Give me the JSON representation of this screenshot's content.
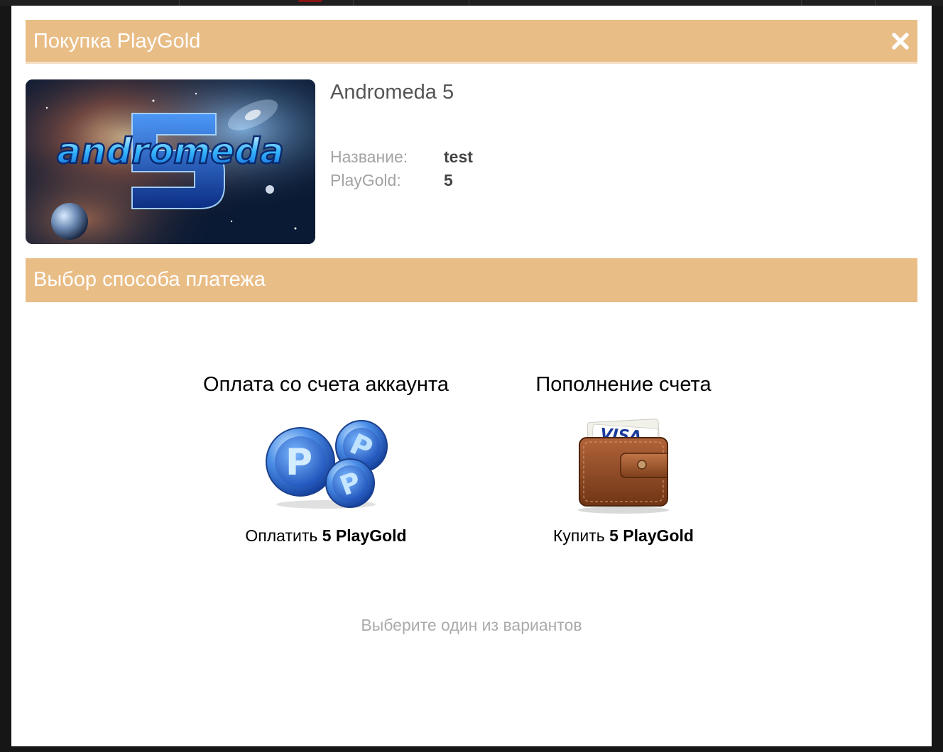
{
  "dialog": {
    "title": "Покупка PlayGold",
    "close_icon": "close-icon"
  },
  "product": {
    "image_alt": "andromeda",
    "image_number": "5",
    "name": "Andromeda 5",
    "fields": [
      {
        "label": "Название:",
        "value": "test"
      },
      {
        "label": "PlayGold:",
        "value": "5"
      }
    ]
  },
  "payment": {
    "section_title": "Выбор способа платежа",
    "options": [
      {
        "title": "Оплата со счета аккаунта",
        "icon": "playgold-coins-icon",
        "action_prefix": "Оплатить",
        "action_amount": "5 PlayGold"
      },
      {
        "title": "Пополнение счета",
        "icon": "wallet-icon",
        "card_text": "VISA",
        "action_prefix": "Купить",
        "action_amount": "5 PlayGold"
      }
    ],
    "hint": "Выберите один из вариантов"
  },
  "colors": {
    "header_bar": "#e9bd86",
    "backdrop": "#161616"
  }
}
